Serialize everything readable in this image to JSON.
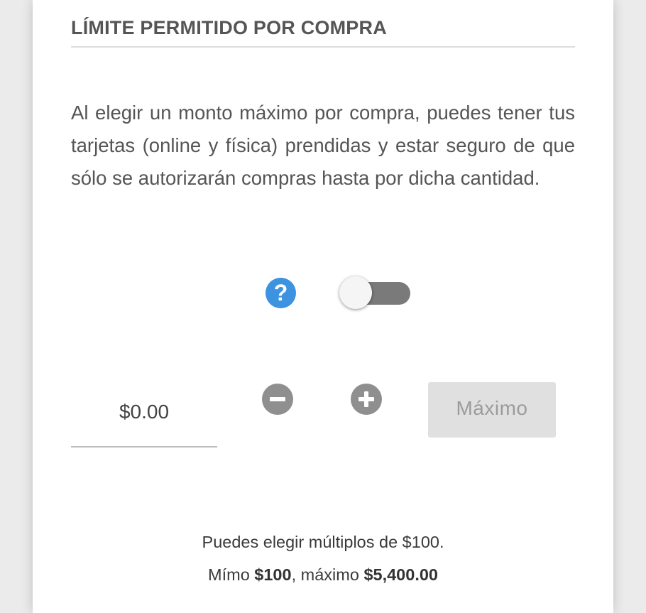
{
  "section": {
    "title": "LÍMITE PERMITIDO POR COMPRA",
    "description": "Al elegir un monto máximo por compra, puedes tener tus tarjetas (online y física) prendidas y estar seguro de que sólo se autorizarán compras hasta por dicha cantidad."
  },
  "controls": {
    "help_icon_glyph": "?",
    "help_icon_name": "question-mark-icon",
    "toggle_state": "off",
    "amount_value": "$0.00",
    "decrement_icon_name": "minus-icon",
    "increment_icon_name": "plus-icon",
    "max_button_label": "Máximo"
  },
  "hints": {
    "line1": "Puedes elegir múltiplos de $100.",
    "line2_prefix": "Mímo ",
    "line2_min": "$100",
    "line2_middle": ", máximo ",
    "line2_max": "$5,400.00"
  },
  "colors": {
    "help_icon": "#3d93df",
    "toggle_track_off": "#7a7a7a",
    "round_buttons": "#8f8f8f",
    "max_button_bg": "#e0e0e0",
    "max_button_text": "#9b9b9b"
  }
}
